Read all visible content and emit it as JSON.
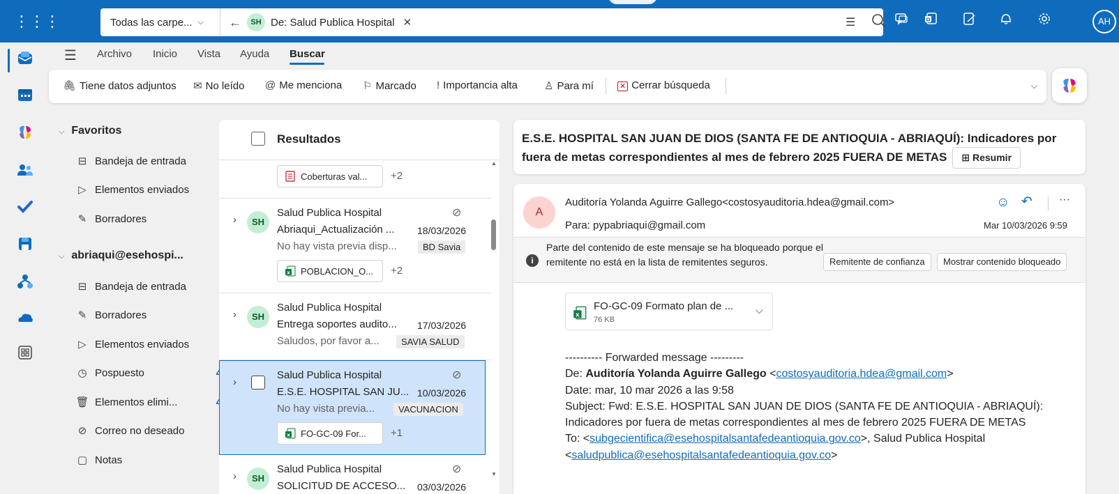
{
  "topbar": {
    "folder_scope": "Todas las carpe...",
    "chip_initials": "SH",
    "chip_text": "De: Salud Publica Hospital",
    "user_initials": "AH"
  },
  "ribbon": {
    "tabs": [
      "Archivo",
      "Inicio",
      "Vista",
      "Ayuda",
      "Buscar"
    ]
  },
  "filters": {
    "attachments": "Tiene datos adjuntos",
    "unread": "No leído",
    "mentions": "Me menciona",
    "flagged": "Marcado",
    "important": "Importancia alta",
    "to_me": "Para mí",
    "close_search": "Cerrar búsqueda"
  },
  "folders": {
    "favorites_header": "Favoritos",
    "favorites": [
      {
        "label": "Bandeja de entrada"
      },
      {
        "label": "Elementos enviados"
      },
      {
        "label": "Borradores"
      }
    ],
    "account_header": "abriaqui@esehospi...",
    "account_items": [
      {
        "label": "Bandeja de entrada",
        "count": ""
      },
      {
        "label": "Borradores",
        "count": ""
      },
      {
        "label": "Elementos enviados",
        "count": ""
      },
      {
        "label": "Pospuesto",
        "count": "4"
      },
      {
        "label": "Elementos elimi...",
        "count": "4"
      },
      {
        "label": "Correo no deseado",
        "count": ""
      },
      {
        "label": "Notas",
        "count": ""
      }
    ]
  },
  "list": {
    "header": "Resultados",
    "top_attachment": {
      "name": "Coberturas val...",
      "more": "+2"
    },
    "items": [
      {
        "sender": "Salud Publica Hospital",
        "subject": "Abriaqui_Actualización ...",
        "date": "18/03/2026",
        "preview": "No hay vista previa disp...",
        "tag": "BD Savia",
        "attachment": "POBLACION_O...",
        "more": "+2"
      },
      {
        "sender": "Salud Publica Hospital",
        "subject": "Entrega soportes audito...",
        "date": "17/03/2026",
        "preview": "Saludos, por favor a...",
        "tag": "SAVIA SALUD"
      },
      {
        "sender": "Salud Publica Hospital",
        "subject": "E.S.E. HOSPITAL SAN JU...",
        "date": "10/03/2026",
        "preview": "No hay vista previa...",
        "tag": "VACUNACION",
        "attachment": "FO-GC-09 For...",
        "more": "+1"
      },
      {
        "sender": "Salud Publica Hospital",
        "subject": "SOLICITUD DE ACCESO...",
        "date": "03/03/2026"
      }
    ]
  },
  "reading": {
    "subject": "E.S.E. HOSPITAL SAN JUAN DE DIOS (SANTA FE DE ANTIOQUIA - ABRIAQUÍ): Indicadores por fuera de metas correspondientes al mes de febrero 2025 FUERA DE METAS",
    "summarize": "Resumir",
    "from_initial": "A",
    "from": "Auditoría Yolanda Aguirre Gallego<costosyauditoria.hdea@gmail.com>",
    "to": "Para:  pypabriaqui@gmail.com",
    "date": "Mar 10/03/2026 9:59",
    "blocked_text": "Parte del contenido de este mensaje se ha bloqueado porque el remitente no está en la lista de remitentes seguros.",
    "trust_button": "Remitente de confianza",
    "show_button": "Mostrar contenido bloqueado",
    "attachment_name": "FO-GC-09 Formato plan de ...",
    "attachment_size": "76 KB",
    "body": {
      "forward_line": "---------- Forwarded message ---------",
      "de_label": "De: ",
      "de_name": "Auditoría Yolanda Aguirre Gallego",
      "de_email": "costosyauditoria.hdea@gmail.com",
      "date_line": "Date: mar, 10 mar 2026 a las 9:58",
      "subject_line": "Subject: Fwd: E.S.E. HOSPITAL SAN JUAN DE DIOS (SANTA FE DE ANTIOQUIA - ABRIAQUÍ): Indicadores por fuera de metas correspondientes al mes de febrero 2025 FUERA DE METAS",
      "to_label": "To: ",
      "to_email_1": "subgecientifica@esehospitalsantafedeantioquia.gov.co",
      "to_middle": ", Salud Publica Hospital",
      "to_email_2": "saludpublica@esehospitalsantafedeantioquia.gov.co"
    }
  },
  "colors": {
    "brand": "#0f6cbd",
    "selected_row": "#cfe4fa",
    "avatar_green": "#c3eed6",
    "avatar_pink": "#fbd3d1"
  }
}
